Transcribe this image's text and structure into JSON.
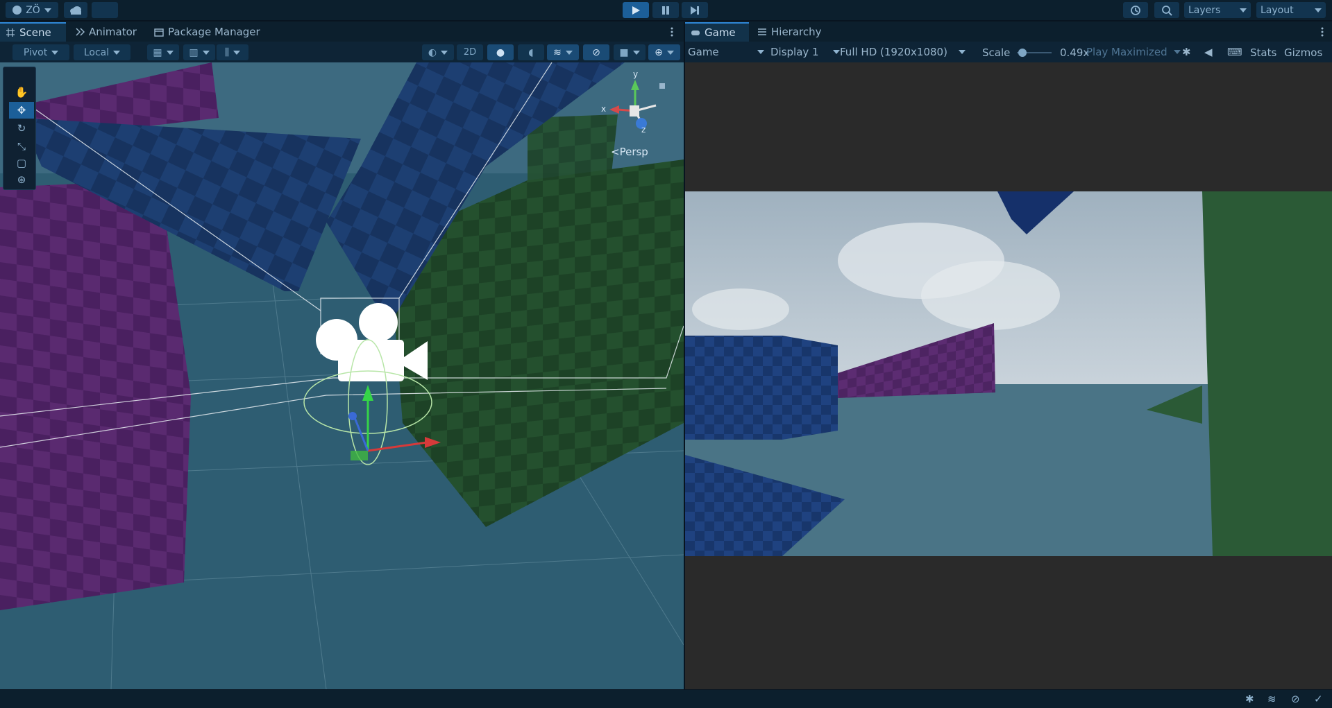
{
  "top": {
    "account_label": "ZÖ",
    "layers_label": "Layers",
    "layout_label": "Layout"
  },
  "scene_panel": {
    "tabs": [
      {
        "label": "Scene",
        "icon": "grid-icon",
        "active": true
      },
      {
        "label": "Animator",
        "icon": "animator-icon",
        "active": false
      },
      {
        "label": "Package Manager",
        "icon": "package-icon",
        "active": false
      }
    ],
    "pivot_label": "Pivot",
    "local_label": "Local",
    "twod_label": "2D",
    "persp_label": "Persp",
    "gizmo_axes": {
      "x": "x",
      "y": "y",
      "z": "z"
    }
  },
  "game_panel": {
    "tabs": [
      {
        "label": "Game",
        "icon": "gamepad-icon",
        "active": true
      },
      {
        "label": "Hierarchy",
        "icon": "hierarchy-icon",
        "active": false
      }
    ],
    "view_select": "Game",
    "display_select": "Display 1",
    "resolution_select": "Full HD (1920x1080)",
    "scale_label": "Scale",
    "scale_value": "0.49x",
    "play_mode_select": "Play Maximized",
    "stats_label": "Stats",
    "gizmos_label": "Gizmos"
  },
  "colors": {
    "accent": "#2f87d6",
    "purple_block": "#5a2a70",
    "blue_block": "#1d3f72",
    "green_block": "#24502e",
    "ground": "#2d5a6e",
    "game_bg": "#2a2a2a"
  }
}
